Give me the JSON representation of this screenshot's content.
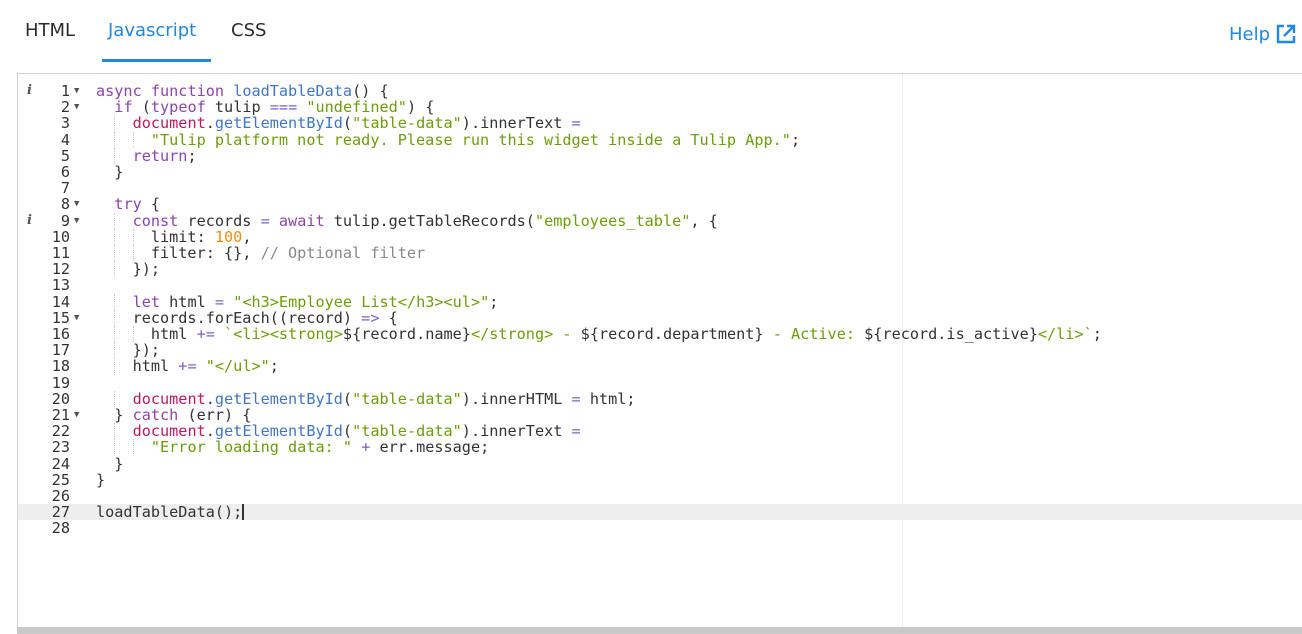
{
  "tabs": [
    {
      "label": "HTML",
      "active": false
    },
    {
      "label": "Javascript",
      "active": true
    },
    {
      "label": "CSS",
      "active": false
    }
  ],
  "help": {
    "label": "Help",
    "icon": "external-link-icon"
  },
  "colors": {
    "accent": "#1f87e5",
    "keyword": "#8e44ad",
    "string": "#6b9e0a",
    "number": "#f28c13",
    "object": "#c2185b",
    "comment": "#888888"
  },
  "editor": {
    "language": "javascript",
    "active_line": 27,
    "info_lines": [
      1,
      9
    ],
    "fold_lines": [
      1,
      2,
      8,
      9,
      15,
      21
    ],
    "lines": [
      "async function loadTableData() {",
      "  if (typeof tulip === \"undefined\") {",
      "    document.getElementById(\"table-data\").innerText =",
      "      \"Tulip platform not ready. Please run this widget inside a Tulip App.\";",
      "    return;",
      "  }",
      "",
      "  try {",
      "    const records = await tulip.getTableRecords(\"employees_table\", {",
      "      limit: 100,",
      "      filter: {}, // Optional filter",
      "    });",
      "",
      "    let html = \"<h3>Employee List</h3><ul>\";",
      "    records.forEach((record) => {",
      "      html += `<li><strong>${record.name}</strong> - ${record.department} - Active: ${record.is_active}</li>`;",
      "    });",
      "    html += \"</ul>\";",
      "",
      "    document.getElementById(\"table-data\").innerHTML = html;",
      "  } catch (err) {",
      "    document.getElementById(\"table-data\").innerText =",
      "      \"Error loading data: \" + err.message;",
      "  }",
      "}",
      "",
      "loadTableData();",
      ""
    ]
  }
}
